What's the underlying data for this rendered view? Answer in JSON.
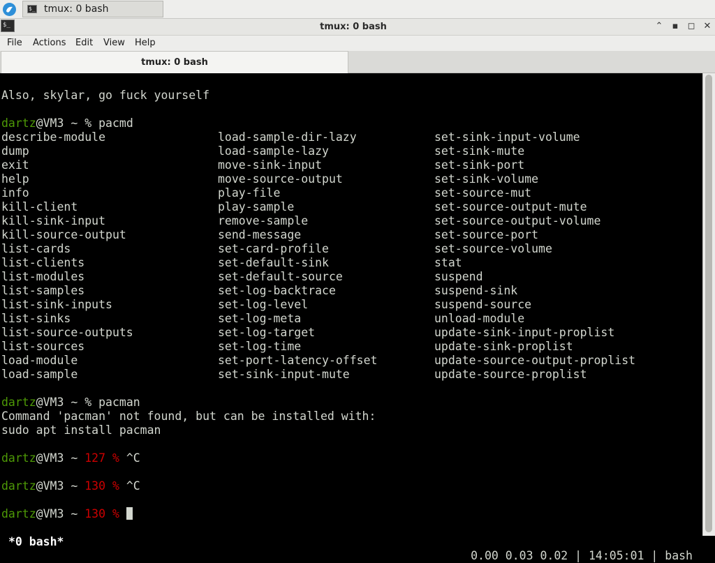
{
  "taskbar": {
    "task_label": "tmux: 0 bash",
    "terminal_icon_glyph": "$_"
  },
  "window": {
    "title": "tmux: 0 bash",
    "controls": {
      "up": "⌃",
      "minimize": "▪",
      "maximize": "◻",
      "close": "✕"
    }
  },
  "menu": [
    "File",
    "Actions",
    "Edit",
    "View",
    "Help"
  ],
  "tab": {
    "label": "tmux: 0 bash"
  },
  "terminal": {
    "line_also": "Also, skylar, go fuck yourself",
    "prompt_user": "dartz",
    "prompt_host_suffix": "@VM3 ~ ",
    "prompt_symbol": "%",
    "cmd1": " pacmd",
    "cmd2": " pacman",
    "pacmd_columns": [
      [
        "describe-module",
        "dump",
        "exit",
        "help",
        "info",
        "kill-client",
        "kill-sink-input",
        "kill-source-output",
        "list-cards",
        "list-clients",
        "list-modules",
        "list-samples",
        "list-sink-inputs",
        "list-sinks",
        "list-source-outputs",
        "list-sources",
        "load-module",
        "load-sample"
      ],
      [
        "load-sample-dir-lazy",
        "load-sample-lazy",
        "move-sink-input",
        "move-source-output",
        "play-file",
        "play-sample",
        "remove-sample",
        "send-message",
        "set-card-profile",
        "set-default-sink",
        "set-default-source",
        "set-log-backtrace",
        "set-log-level",
        "set-log-meta",
        "set-log-target",
        "set-log-time",
        "set-port-latency-offset",
        "set-sink-input-mute"
      ],
      [
        "set-sink-input-volume",
        "set-sink-mute",
        "set-sink-port",
        "set-sink-volume",
        "set-source-mut",
        "set-source-output-mute",
        "set-source-output-volume",
        "set-source-port",
        "set-source-volume",
        "stat",
        "suspend",
        "suspend-sink",
        "suspend-source",
        "unload-module",
        "update-sink-input-proplist",
        "update-sink-proplist",
        "update-source-output-proplist",
        "update-source-proplist"
      ]
    ],
    "not_found": "Command 'pacman' not found, but can be installed with:",
    "install_hint": "sudo apt install pacman",
    "exit_127": "127 % ",
    "exit_130": "130 % ",
    "ctrl_c": "^C"
  },
  "tmux_status": {
    "left": "*0 bash*",
    "right": "0.00 0.03 0.02 | 14:05:01 | bash"
  }
}
